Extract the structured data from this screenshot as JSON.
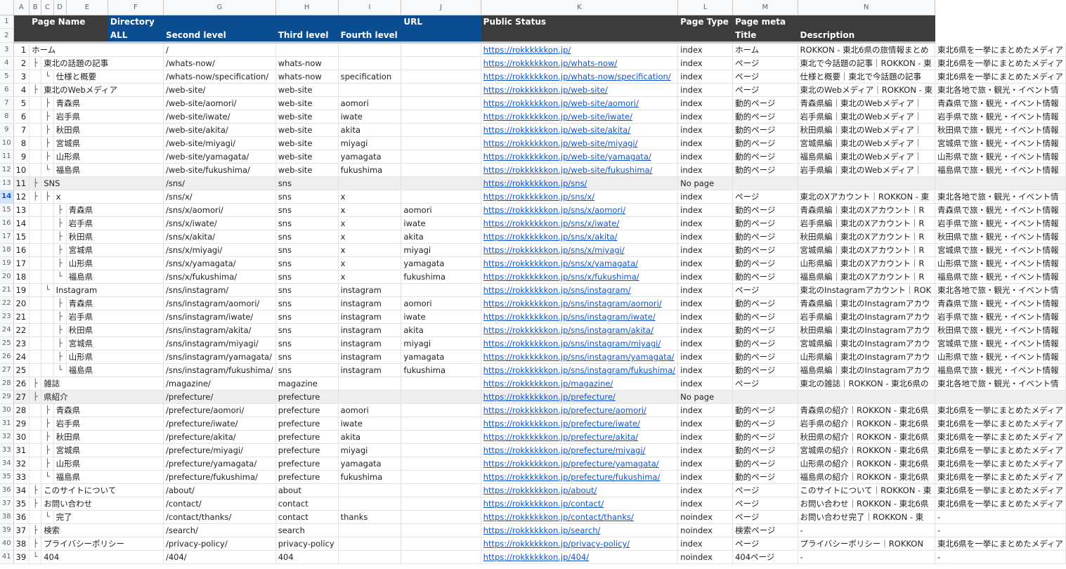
{
  "column_letters": [
    "A",
    "B",
    "C",
    "D",
    "E",
    "F",
    "G",
    "H",
    "I",
    "J",
    "K",
    "L",
    "M",
    "N"
  ],
  "header": {
    "row1": {
      "page_name": "Page Name",
      "directory": "Directory",
      "url": "URL",
      "public_status": "Public Status",
      "page_type": "Page Type",
      "page_meta": "Page meta"
    },
    "row2": {
      "all": "ALL",
      "second_level": "Second level",
      "third_level": "Third level",
      "fourth_level": "Fourth level",
      "title": "Title",
      "description": "Description"
    }
  },
  "selected_row": 14,
  "rows": [
    {
      "r": 3,
      "n": "1",
      "t1": "",
      "t2": "",
      "name": "ホーム",
      "lvl": 0,
      "all": "/",
      "l2": "",
      "l3": "",
      "l4": "",
      "url": "https://rokkkkkkon.jp/",
      "status": "index",
      "type": "ホーム",
      "title": "ROKKON - 東北6県の旅情報まとめ",
      "desc": "東北6県を一挙にまとめたメディア"
    },
    {
      "r": 4,
      "n": "2",
      "t1": "├",
      "t2": "",
      "name": "東北の話題の記事",
      "lvl": 1,
      "all": "/whats-now/",
      "l2": "whats-now",
      "l3": "",
      "l4": "",
      "url": "https://rokkkkkkon.jp/whats-now/",
      "status": "index",
      "type": "ページ",
      "title": "東北で今話題の記事｜ROKKON - 東",
      "desc": "東北6県を一挙にまとめたメディア"
    },
    {
      "r": 5,
      "n": "3",
      "t1": "",
      "t2": "└",
      "name": "仕様と概要",
      "lvl": 2,
      "all": "/whats-now/specification/",
      "l2": "whats-now",
      "l3": "specification",
      "l4": "",
      "url": "https://rokkkkkkon.jp/whats-now/specification/",
      "status": "index",
      "type": "ページ",
      "title": "仕様と概要｜東北で今話題の記事",
      "desc": "東北6県を一挙にまとめたメディア"
    },
    {
      "r": 6,
      "n": "4",
      "t1": "├",
      "t2": "",
      "name": "東北のWebメディア",
      "lvl": 1,
      "all": "/web-site/",
      "l2": "web-site",
      "l3": "",
      "l4": "",
      "url": "https://rokkkkkkon.jp/web-site/",
      "status": "index",
      "type": "ページ",
      "title": "東北のWebメディア｜ROKKON - 東",
      "desc": "東北各地で旅・観光・イベント情"
    },
    {
      "r": 7,
      "n": "5",
      "t1": "",
      "t2": "├",
      "name": "青森県",
      "lvl": 2,
      "all": "/web-site/aomori/",
      "l2": "web-site",
      "l3": "aomori",
      "l4": "",
      "url": "https://rokkkkkkon.jp/web-site/aomori/",
      "status": "index",
      "type": "動的ページ",
      "title": "青森県編｜東北のWebメディア｜",
      "desc": "青森県で旅・観光・イベント情報"
    },
    {
      "r": 8,
      "n": "6",
      "t1": "",
      "t2": "├",
      "name": "岩手県",
      "lvl": 2,
      "all": "/web-site/iwate/",
      "l2": "web-site",
      "l3": "iwate",
      "l4": "",
      "url": "https://rokkkkkkon.jp/web-site/iwate/",
      "status": "index",
      "type": "動的ページ",
      "title": "岩手県編｜東北のWebメディア｜",
      "desc": "岩手県で旅・観光・イベント情報"
    },
    {
      "r": 9,
      "n": "7",
      "t1": "",
      "t2": "├",
      "name": "秋田県",
      "lvl": 2,
      "all": "/web-site/akita/",
      "l2": "web-site",
      "l3": "akita",
      "l4": "",
      "url": "https://rokkkkkkon.jp/web-site/akita/",
      "status": "index",
      "type": "動的ページ",
      "title": "秋田県編｜東北のWebメディア｜",
      "desc": "秋田県で旅・観光・イベント情報"
    },
    {
      "r": 10,
      "n": "8",
      "t1": "",
      "t2": "├",
      "name": "宮城県",
      "lvl": 2,
      "all": "/web-site/miyagi/",
      "l2": "web-site",
      "l3": "miyagi",
      "l4": "",
      "url": "https://rokkkkkkon.jp/web-site/miyagi/",
      "status": "index",
      "type": "動的ページ",
      "title": "宮城県編｜東北のWebメディア｜",
      "desc": "宮城県で旅・観光・イベント情報"
    },
    {
      "r": 11,
      "n": "9",
      "t1": "",
      "t2": "├",
      "name": "山形県",
      "lvl": 2,
      "all": "/web-site/yamagata/",
      "l2": "web-site",
      "l3": "yamagata",
      "l4": "",
      "url": "https://rokkkkkkon.jp/web-site/yamagata/",
      "status": "index",
      "type": "動的ページ",
      "title": "福島県編｜東北のWebメディア｜",
      "desc": "山形県で旅・観光・イベント情報"
    },
    {
      "r": 12,
      "n": "10",
      "t1": "",
      "t2": "└",
      "name": "福島県",
      "lvl": 2,
      "all": "/web-site/fukushima/",
      "l2": "web-site",
      "l3": "fukushima",
      "l4": "",
      "url": "https://rokkkkkkon.jp/web-site/fukushima/",
      "status": "index",
      "type": "動的ページ",
      "title": "岩手県編｜東北のWebメディア｜",
      "desc": "福島県で旅・観光・イベント情報"
    },
    {
      "r": 13,
      "n": "11",
      "t1": "├",
      "t2": "",
      "name": "SNS",
      "lvl": 1,
      "all": "/sns/",
      "l2": "sns",
      "l3": "",
      "l4": "",
      "url": "https://rokkkkkkon.jp/sns/",
      "status": "No page",
      "type": "",
      "title": "",
      "desc": "",
      "gray": true
    },
    {
      "r": 14,
      "n": "12",
      "t1": "├",
      "t2": "├",
      "name": "x",
      "lvl": 2,
      "all": "/sns/x/",
      "l2": "sns",
      "l3": "x",
      "l4": "",
      "url": "https://rokkkkkkon.jp/sns/x/",
      "status": "index",
      "type": "ページ",
      "title": "東北のXアカウント｜ROKKON - 東",
      "desc": "東北各地で旅・観光・イベント情"
    },
    {
      "r": 15,
      "n": "13",
      "t1": "",
      "t2": "├",
      "name": "青森県",
      "lvl": 3,
      "all": "/sns/x/aomori/",
      "l2": "sns",
      "l3": "x",
      "l4": "aomori",
      "url": "https://rokkkkkkon.jp/sns/x/aomori/",
      "status": "index",
      "type": "動的ページ",
      "title": "青森県編｜東北のXアカウント｜R",
      "desc": "青森県で旅・観光・イベント情報"
    },
    {
      "r": 16,
      "n": "14",
      "t1": "",
      "t2": "├",
      "name": "岩手県",
      "lvl": 3,
      "all": "/sns/x/iwate/",
      "l2": "sns",
      "l3": "x",
      "l4": "iwate",
      "url": "https://rokkkkkkon.jp/sns/x/iwate/",
      "status": "index",
      "type": "動的ページ",
      "title": "岩手県編｜東北のXアカウント｜R",
      "desc": "岩手県で旅・観光・イベント情報"
    },
    {
      "r": 17,
      "n": "15",
      "t1": "",
      "t2": "├",
      "name": "秋田県",
      "lvl": 3,
      "all": "/sns/x/akita/",
      "l2": "sns",
      "l3": "x",
      "l4": "akita",
      "url": "https://rokkkkkkon.jp/sns/x/akita/",
      "status": "index",
      "type": "動的ページ",
      "title": "秋田県編｜東北のXアカウント｜R",
      "desc": "秋田県で旅・観光・イベント情報"
    },
    {
      "r": 18,
      "n": "16",
      "t1": "",
      "t2": "├",
      "name": "宮城県",
      "lvl": 3,
      "all": "/sns/x/miyagi/",
      "l2": "sns",
      "l3": "x",
      "l4": "miyagi",
      "url": "https://rokkkkkkon.jp/sns/x/miyagi/",
      "status": "index",
      "type": "動的ページ",
      "title": "宮城県編｜東北のXアカウント｜R",
      "desc": "宮城県で旅・観光・イベント情報"
    },
    {
      "r": 19,
      "n": "17",
      "t1": "",
      "t2": "├",
      "name": "山形県",
      "lvl": 3,
      "all": "/sns/x/yamagata/",
      "l2": "sns",
      "l3": "x",
      "l4": "yamagata",
      "url": "https://rokkkkkkon.jp/sns/x/yamagata/",
      "status": "index",
      "type": "動的ページ",
      "title": "山形県編｜東北のXアカウント｜R",
      "desc": "山形県で旅・観光・イベント情報"
    },
    {
      "r": 20,
      "n": "18",
      "t1": "",
      "t2": "└",
      "name": "福島県",
      "lvl": 3,
      "all": "/sns/x/fukushima/",
      "l2": "sns",
      "l3": "x",
      "l4": "fukushima",
      "url": "https://rokkkkkkon.jp/sns/x/fukushima/",
      "status": "index",
      "type": "動的ページ",
      "title": "福島県編｜東北のXアカウント｜R",
      "desc": "福島県で旅・観光・イベント情報"
    },
    {
      "r": 21,
      "n": "19",
      "t1": "",
      "t2": "└",
      "name": "Instagram",
      "lvl": 2,
      "all": "/sns/instagram/",
      "l2": "sns",
      "l3": "instagram",
      "l4": "",
      "url": "https://rokkkkkkon.jp/sns/instagram/",
      "status": "index",
      "type": "ページ",
      "title": "東北のInstagramアカウント｜ROK",
      "desc": "東北各地で旅・観光・イベント情"
    },
    {
      "r": 22,
      "n": "20",
      "t1": "",
      "t2": "├",
      "name": "青森県",
      "lvl": 3,
      "all": "/sns/instagram/aomori/",
      "l2": "sns",
      "l3": "instagram",
      "l4": "aomori",
      "url": "https://rokkkkkkon.jp/sns/instagram/aomori/",
      "status": "index",
      "type": "動的ページ",
      "title": "青森県編｜東北のInstagramアカウ",
      "desc": "青森県で旅・観光・イベント情報"
    },
    {
      "r": 23,
      "n": "21",
      "t1": "",
      "t2": "├",
      "name": "岩手県",
      "lvl": 3,
      "all": "/sns/instagram/iwate/",
      "l2": "sns",
      "l3": "instagram",
      "l4": "iwate",
      "url": "https://rokkkkkkon.jp/sns/instagram/iwate/",
      "status": "index",
      "type": "動的ページ",
      "title": "岩手県編｜東北のInstagramアカウ",
      "desc": "岩手県で旅・観光・イベント情報"
    },
    {
      "r": 24,
      "n": "22",
      "t1": "",
      "t2": "├",
      "name": "秋田県",
      "lvl": 3,
      "all": "/sns/instagram/akita/",
      "l2": "sns",
      "l3": "instagram",
      "l4": "akita",
      "url": "https://rokkkkkkon.jp/sns/instagram/akita/",
      "status": "index",
      "type": "動的ページ",
      "title": "秋田県編｜東北のInstagramアカウ",
      "desc": "秋田県で旅・観光・イベント情報"
    },
    {
      "r": 25,
      "n": "23",
      "t1": "",
      "t2": "├",
      "name": "宮城県",
      "lvl": 3,
      "all": "/sns/instagram/miyagi/",
      "l2": "sns",
      "l3": "instagram",
      "l4": "miyagi",
      "url": "https://rokkkkkkon.jp/sns/instagram/miyagi/",
      "status": "index",
      "type": "動的ページ",
      "title": "宮城県編｜東北のInstagramアカウ",
      "desc": "宮城県で旅・観光・イベント情報"
    },
    {
      "r": 26,
      "n": "24",
      "t1": "",
      "t2": "├",
      "name": "山形県",
      "lvl": 3,
      "all": "/sns/instagram/yamagata/",
      "l2": "sns",
      "l3": "instagram",
      "l4": "yamagata",
      "url": "https://rokkkkkkon.jp/sns/instagram/yamagata/",
      "status": "index",
      "type": "動的ページ",
      "title": "山形県編｜東北のInstagramアカウ",
      "desc": "山形県で旅・観光・イベント情報"
    },
    {
      "r": 27,
      "n": "25",
      "t1": "",
      "t2": "└",
      "name": "福島県",
      "lvl": 3,
      "all": "/sns/instagram/fukushima/",
      "l2": "sns",
      "l3": "instagram",
      "l4": "fukushima",
      "url": "https://rokkkkkkon.jp/sns/instagram/fukushima/",
      "status": "index",
      "type": "動的ページ",
      "title": "福島県編｜東北のInstagramアカウ",
      "desc": "福島県で旅・観光・イベント情報"
    },
    {
      "r": 28,
      "n": "26",
      "t1": "├",
      "t2": "",
      "name": "雑誌",
      "lvl": 1,
      "all": "/magazine/",
      "l2": "magazine",
      "l3": "",
      "l4": "",
      "url": "https://rokkkkkkon.jp/magazine/",
      "status": "index",
      "type": "ページ",
      "title": "東北の雑誌｜ROKKON - 東北6県の",
      "desc": "東北各地で旅・観光・イベント情"
    },
    {
      "r": 29,
      "n": "27",
      "t1": "├",
      "t2": "",
      "name": "県紹介",
      "lvl": 1,
      "all": "/prefecture/",
      "l2": "prefecture",
      "l3": "",
      "l4": "",
      "url": "https://rokkkkkkon.jp/prefecture/",
      "status": "No page",
      "type": "",
      "title": "",
      "desc": "",
      "gray": true
    },
    {
      "r": 30,
      "n": "28",
      "t1": "",
      "t2": "├",
      "name": "青森県",
      "lvl": 2,
      "all": "/prefecture/aomori/",
      "l2": "prefecture",
      "l3": "aomori",
      "l4": "",
      "url": "https://rokkkkkkon.jp/prefecture/aomori/",
      "status": "index",
      "type": "動的ページ",
      "title": "青森県の紹介｜ROKKON - 東北6県",
      "desc": "東北6県を一挙にまとめたメディア"
    },
    {
      "r": 31,
      "n": "29",
      "t1": "",
      "t2": "├",
      "name": "岩手県",
      "lvl": 2,
      "all": "/prefecture/iwate/",
      "l2": "prefecture",
      "l3": "iwate",
      "l4": "",
      "url": "https://rokkkkkkon.jp/prefecture/iwate/",
      "status": "index",
      "type": "動的ページ",
      "title": "岩手県の紹介｜ROKKON - 東北6県",
      "desc": "東北6県を一挙にまとめたメディア"
    },
    {
      "r": 32,
      "n": "30",
      "t1": "",
      "t2": "├",
      "name": "秋田県",
      "lvl": 2,
      "all": "/prefecture/akita/",
      "l2": "prefecture",
      "l3": "akita",
      "l4": "",
      "url": "https://rokkkkkkon.jp/prefecture/akita/",
      "status": "index",
      "type": "動的ページ",
      "title": "秋田県の紹介｜ROKKON - 東北6県",
      "desc": "東北6県を一挙にまとめたメディア"
    },
    {
      "r": 33,
      "n": "31",
      "t1": "",
      "t2": "├",
      "name": "宮城県",
      "lvl": 2,
      "all": "/prefecture/miyagi/",
      "l2": "prefecture",
      "l3": "miyagi",
      "l4": "",
      "url": "https://rokkkkkkon.jp/prefecture/miyagi/",
      "status": "index",
      "type": "動的ページ",
      "title": "宮城県の紹介｜ROKKON - 東北6県",
      "desc": "東北6県を一挙にまとめたメディア"
    },
    {
      "r": 34,
      "n": "32",
      "t1": "",
      "t2": "├",
      "name": "山形県",
      "lvl": 2,
      "all": "/prefecture/yamagata/",
      "l2": "prefecture",
      "l3": "yamagata",
      "l4": "",
      "url": "https://rokkkkkkon.jp/prefecture/yamagata/",
      "status": "index",
      "type": "動的ページ",
      "title": "山形県の紹介｜ROKKON - 東北6県",
      "desc": "東北6県を一挙にまとめたメディア"
    },
    {
      "r": 35,
      "n": "33",
      "t1": "",
      "t2": "└",
      "name": "福島県",
      "lvl": 2,
      "all": "/prefecture/fukushima/",
      "l2": "prefecture",
      "l3": "fukushima",
      "l4": "",
      "url": "https://rokkkkkkon.jp/prefecture/fukushima/",
      "status": "index",
      "type": "動的ページ",
      "title": "福島県の紹介｜ROKKON - 東北6県",
      "desc": "東北6県を一挙にまとめたメディア"
    },
    {
      "r": 36,
      "n": "34",
      "t1": "├",
      "t2": "",
      "name": "このサイトについて",
      "lvl": 1,
      "all": "/about/",
      "l2": "about",
      "l3": "",
      "l4": "",
      "url": "https://rokkkkkkon.jp/about/",
      "status": "index",
      "type": "ページ",
      "title": "このサイトについて｜ROKKON - 東",
      "desc": "東北6県を一挙にまとめたメディア"
    },
    {
      "r": 37,
      "n": "35",
      "t1": "├",
      "t2": "",
      "name": "お問い合わせ",
      "lvl": 1,
      "all": "/contact/",
      "l2": "contact",
      "l3": "",
      "l4": "",
      "url": "https://rokkkkkkon.jp/contact/",
      "status": "index",
      "type": "ページ",
      "title": "お問い合わせ｜ROKKON - 東北6県",
      "desc": "東北6県を一挙にまとめたメディア"
    },
    {
      "r": 38,
      "n": "36",
      "t1": "",
      "t2": "└",
      "name": "完了",
      "lvl": 2,
      "all": "/contact/thanks/",
      "l2": "contact",
      "l3": "thanks",
      "l4": "",
      "url": "https://rokkkkkkon.jp/contact/thanks/",
      "status": "noindex",
      "type": "ページ",
      "title": "お問い合わせ完了｜ROKKON - 東",
      "desc": "-"
    },
    {
      "r": 39,
      "n": "37",
      "t1": "├",
      "t2": "",
      "name": "検索",
      "lvl": 1,
      "all": "/search/",
      "l2": "search",
      "l3": "",
      "l4": "",
      "url": "https://rokkkkkkon.jp/search/",
      "status": "noindex",
      "type": "検索ページ",
      "title": "-",
      "desc": "-"
    },
    {
      "r": 40,
      "n": "38",
      "t1": "├",
      "t2": "",
      "name": "プライバシーポリシー",
      "lvl": 1,
      "all": "/privacy-policy/",
      "l2": "privacy-policy",
      "l3": "",
      "l4": "",
      "url": "https://rokkkkkkon.jp/privacy-policy/",
      "status": "index",
      "type": "ページ",
      "title": "プライバシーポリシー｜ROKKON",
      "desc": "東北6県を一挙にまとめたメディア"
    },
    {
      "r": 41,
      "n": "39",
      "t1": "└",
      "t2": "",
      "name": "404",
      "lvl": 1,
      "all": "/404/",
      "l2": "404",
      "l3": "",
      "l4": "",
      "url": "https://rokkkkkkon.jp/404/",
      "status": "noindex",
      "type": "404ページ",
      "title": "-",
      "desc": "-"
    }
  ]
}
